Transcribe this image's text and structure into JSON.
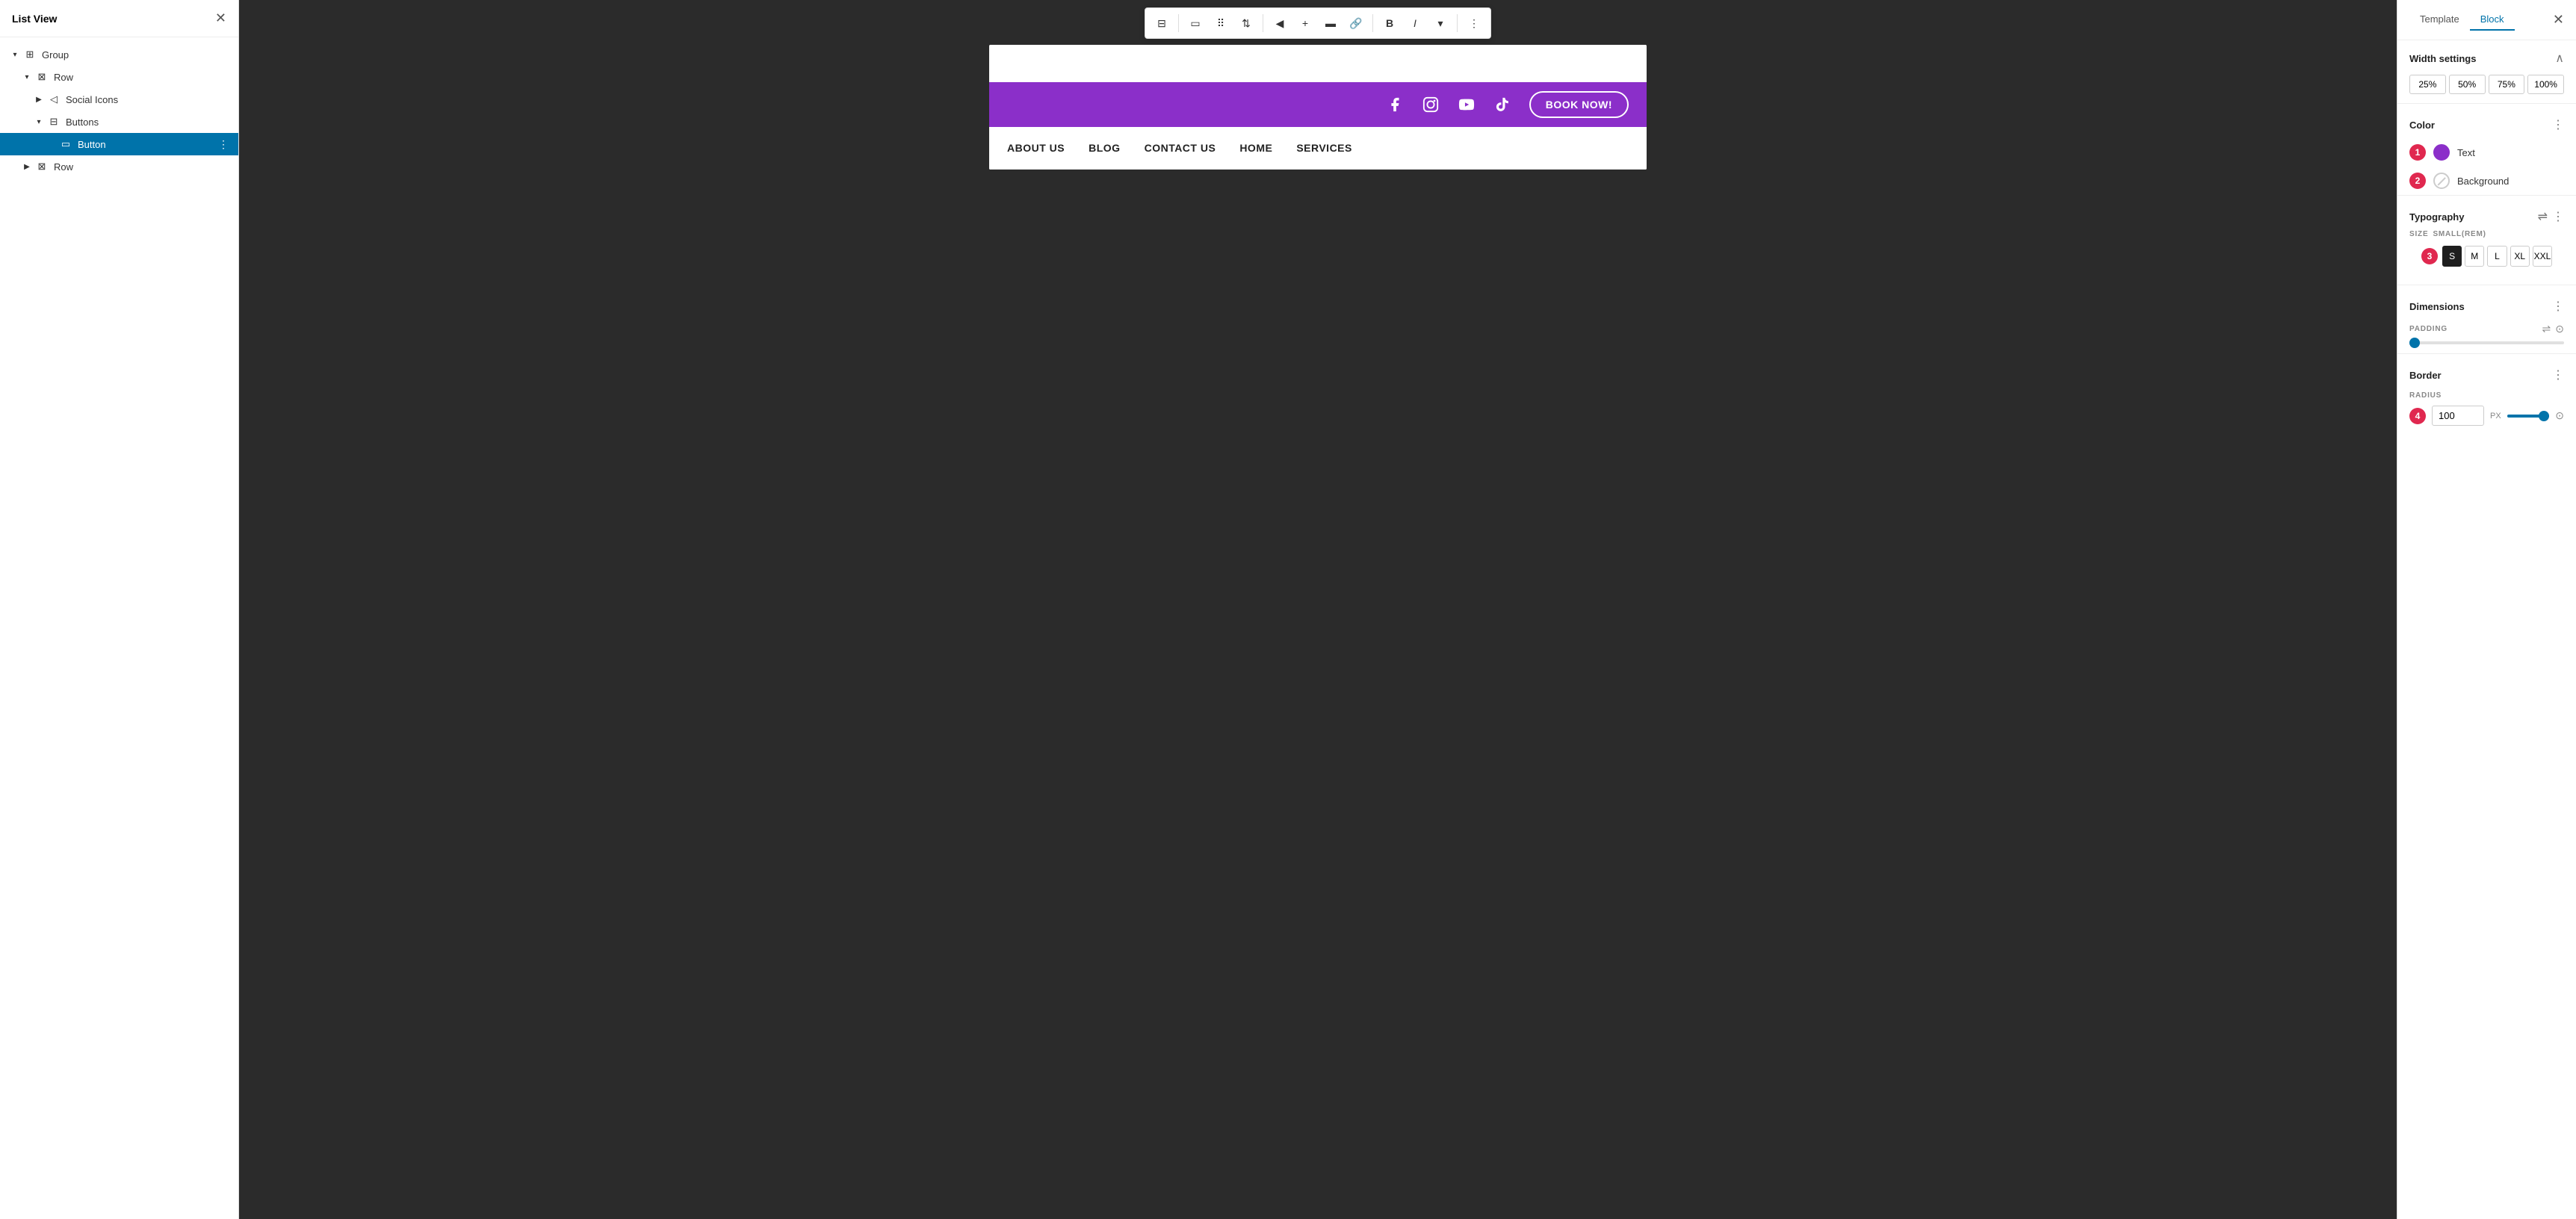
{
  "leftPanel": {
    "title": "List View",
    "closeBtn": "✕",
    "tree": [
      {
        "id": "group",
        "label": "Group",
        "indent": 0,
        "icon": "⊞",
        "chevron": "▾",
        "expanded": true
      },
      {
        "id": "row1",
        "label": "Row",
        "indent": 1,
        "icon": "⊠",
        "chevron": "▾",
        "expanded": true
      },
      {
        "id": "social-icons",
        "label": "Social Icons",
        "indent": 2,
        "icon": "◁",
        "chevron": "▶",
        "expanded": false
      },
      {
        "id": "buttons",
        "label": "Buttons",
        "indent": 2,
        "icon": "⊟",
        "chevron": "▾",
        "expanded": true
      },
      {
        "id": "button",
        "label": "Button",
        "indent": 3,
        "icon": "▭",
        "chevron": "",
        "expanded": false,
        "selected": true
      },
      {
        "id": "row2",
        "label": "Row",
        "indent": 1,
        "icon": "⊠",
        "chevron": "▶",
        "expanded": false
      }
    ]
  },
  "canvas": {
    "nav": {
      "items": [
        "ABOUT US",
        "BLOG",
        "CONTACT US",
        "HOME",
        "SERVICES"
      ]
    },
    "purpleBar": {
      "bookNowLabel": "BOOK NOW!",
      "bgColor": "#8b2fc9"
    },
    "toolbar": {
      "buttons": [
        "⊟",
        "▭",
        "⠿",
        "▲▼",
        "|",
        "◀",
        "+",
        "▬",
        "⊞",
        "🔗",
        "B",
        "I",
        "▾",
        "⋮"
      ]
    }
  },
  "rightPanel": {
    "tabs": [
      "Template",
      "Block"
    ],
    "activeTab": "Block",
    "closeBtn": "✕",
    "widthSettings": {
      "title": "Width settings",
      "options": [
        "25%",
        "50%",
        "75%",
        "100%"
      ]
    },
    "color": {
      "title": "Color",
      "menuIcon": "⋮",
      "items": [
        {
          "id": "text-color",
          "label": "Text",
          "swatch": "#8b2fc9"
        },
        {
          "id": "bg-color",
          "label": "Background",
          "swatch": ""
        }
      ]
    },
    "typography": {
      "title": "Typography",
      "menuIcon": "⋮",
      "sizeLabel": "SIZE",
      "sizeValue": "SMALL(REM)",
      "sizes": [
        "S",
        "M",
        "L",
        "XL",
        "XXL"
      ],
      "activeSize": "S"
    },
    "dimensions": {
      "title": "Dimensions",
      "menuIcon": "⋮",
      "paddingLabel": "PADDING",
      "sliderValue": 0
    },
    "border": {
      "title": "Border",
      "menuIcon": "⋮",
      "radiusLabel": "RADIUS",
      "radiusValue": "100",
      "radiusUnit": "PX"
    },
    "badges": {
      "1": "1",
      "2": "2",
      "3": "3",
      "4": "4"
    }
  }
}
